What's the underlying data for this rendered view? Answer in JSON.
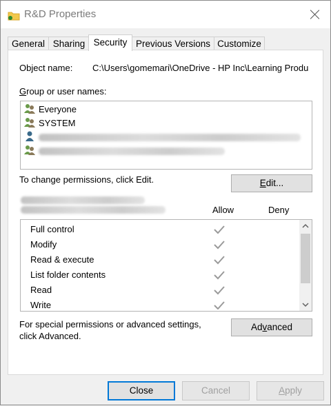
{
  "window": {
    "title": "R&D Properties"
  },
  "tabs": [
    {
      "label": "General"
    },
    {
      "label": "Sharing"
    },
    {
      "label": "Security"
    },
    {
      "label": "Previous Versions"
    },
    {
      "label": "Customize"
    }
  ],
  "security": {
    "object_name_label": "Object name:",
    "object_name_value": "C:\\Users\\gomemari\\OneDrive - HP Inc\\Learning Produ",
    "group_label_prefix": "G",
    "group_label_rest": "roup or user names:",
    "groups": [
      {
        "name": "Everyone",
        "icon": "group-users-icon"
      },
      {
        "name": "SYSTEM",
        "icon": "group-users-icon"
      },
      {
        "name": "",
        "icon": "user-icon"
      },
      {
        "name": "",
        "icon": "group-users-icon"
      }
    ],
    "change_text": "To change permissions, click Edit.",
    "edit_prefix": "E",
    "edit_rest": "dit...",
    "allow_label": "Allow",
    "deny_label": "Deny",
    "permissions": [
      {
        "name": "Full control",
        "allow": true,
        "deny": false
      },
      {
        "name": "Modify",
        "allow": true,
        "deny": false
      },
      {
        "name": "Read & execute",
        "allow": true,
        "deny": false
      },
      {
        "name": "List folder contents",
        "allow": true,
        "deny": false
      },
      {
        "name": "Read",
        "allow": true,
        "deny": false
      },
      {
        "name": "Write",
        "allow": true,
        "deny": false
      }
    ],
    "special_text_line1": "For special permissions or advanced settings,",
    "special_text_line2": "click Advanced.",
    "advanced_pre": "Ad",
    "advanced_u": "v",
    "advanced_post": "anced"
  },
  "footer": {
    "close": "Close",
    "cancel": "Cancel",
    "apply_prefix": "A",
    "apply_rest": "pply"
  },
  "colors": {
    "focus_blue": "#0078d7",
    "check_gray": "#9a9a9a"
  }
}
